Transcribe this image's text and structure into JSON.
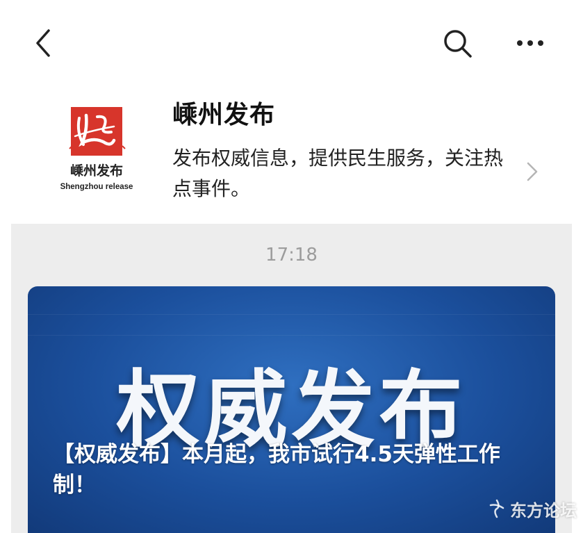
{
  "header": {
    "back_icon": "chevron-left-icon",
    "search_icon": "search-icon",
    "more_icon": "more-dots-icon"
  },
  "account": {
    "logo_icon": "shengzhou-release-logo",
    "logo_text_cn": "嵊州发布",
    "logo_text_en": "Shengzhou release",
    "logo_color": "#d7352b",
    "name": "嵊州发布",
    "description": "发布权威信息，提供民生服务，关注热点事件。",
    "chevron_icon": "chevron-right-icon"
  },
  "messages": {
    "time": "17:18",
    "article": {
      "cover_headline": "权威发布",
      "title": "【权威发布】本月起，我市试行4.5天弹性工作制！",
      "cover_color": "#1b4f9c"
    }
  },
  "watermark": {
    "text": "东方论坛"
  }
}
